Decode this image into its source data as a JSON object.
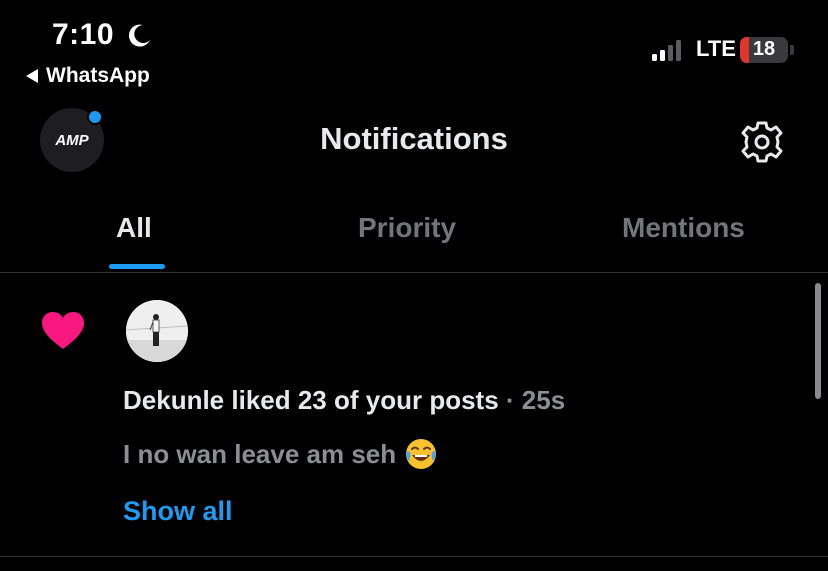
{
  "status_bar": {
    "time": "7:10",
    "back_app_label": "WhatsApp",
    "network": "LTE",
    "battery_level": "18",
    "battery_fraction": 0.18
  },
  "header": {
    "avatar_text": "AMP",
    "title": "Notifications"
  },
  "tabs": [
    {
      "label": "All",
      "active": true
    },
    {
      "label": "Priority",
      "active": false
    },
    {
      "label": "Mentions",
      "active": false
    }
  ],
  "notification": {
    "type_icon": "heart-icon",
    "message": "Dekunle liked 23 of your posts",
    "separator": "·",
    "time_ago": "25s",
    "post_text": "I no wan leave am seh",
    "emoji": "face-with-tears-of-joy",
    "show_all_label": "Show all"
  },
  "colors": {
    "accent": "#1d9bf0",
    "like": "#f91880",
    "battery_low": "#e0352b",
    "background": "#000000"
  }
}
